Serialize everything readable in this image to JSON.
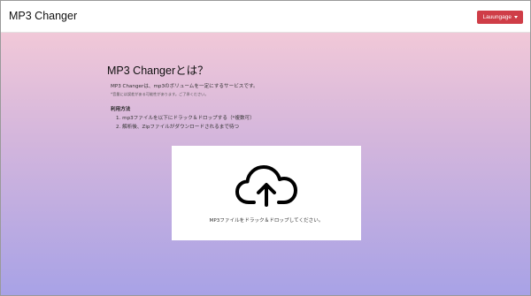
{
  "navbar": {
    "brand": "MP3 Changer",
    "language_button": "Lauungage"
  },
  "intro": {
    "title": "MP3 Changerとは？",
    "description": "MP3 Changerは、mp3のボリュームを一定にするサービスです。",
    "note": "*音量には誤差がある可能性があります。ご了承ください。",
    "usage_heading": "利用方法",
    "steps": [
      "1. mp3ファイルを以下にドラック＆ドロップする（*複数可）",
      "2. 解析後、Zipファイルがダウンロードされるまで待つ"
    ]
  },
  "dropzone": {
    "icon": "cloud-upload-icon",
    "text": "MP3ファイルをドラック＆ドロップしてください。"
  },
  "colors": {
    "accent_button": "#cf3d47",
    "gradient_top": "#f1c8d8",
    "gradient_bottom": "#a8a2e6"
  }
}
